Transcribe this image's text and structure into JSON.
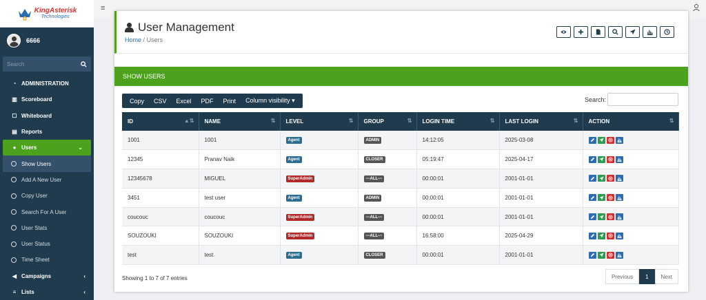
{
  "brand": {
    "name": "KingAsterisk",
    "sub": "Technologies"
  },
  "user": {
    "name": "6666"
  },
  "sidebar_search": {
    "placeholder": "Search"
  },
  "nav": {
    "administration": "ADMINISTRATION",
    "scoreboard": "Scoreboard",
    "whiteboard": "Whiteboard",
    "reports": "Reports",
    "users": "Users",
    "campaigns": "Campaigns",
    "lists": "Lists"
  },
  "sub_nav": [
    "Show Users",
    "Add A New User",
    "Copy User",
    "Search For A User",
    "User Stats",
    "User Status",
    "Time Sheet"
  ],
  "page": {
    "title": "User Management",
    "breadcrumb_home": "Home",
    "breadcrumb_sep": "/",
    "breadcrumb_current": "Users"
  },
  "section_header": "SHOW USERS",
  "export": {
    "copy": "Copy",
    "csv": "CSV",
    "excel": "Excel",
    "pdf": "PDF",
    "print": "Print",
    "colvis": "Column visibility ▾"
  },
  "table_search_label": "Search:",
  "columns": [
    "ID",
    "NAME",
    "LEVEL",
    "GROUP",
    "LOGIN TIME",
    "LAST LOGIN",
    "ACTION"
  ],
  "rows": [
    {
      "id": "1001",
      "name": "1001",
      "level": "Agent",
      "group": "ADMIN",
      "login": "14:12:05",
      "last": "2025-03-08"
    },
    {
      "id": "12345",
      "name": "Pranav Naik",
      "level": "Agent",
      "group": "CLOSER",
      "login": "05:19:47",
      "last": "2025-04-17"
    },
    {
      "id": "12345678",
      "name": "MIGUEL",
      "level": "SuperAdmin",
      "group": "---ALL---",
      "login": "00:00:01",
      "last": "2001-01-01"
    },
    {
      "id": "3451",
      "name": "test user",
      "level": "Agent",
      "group": "ADMIN",
      "login": "00:00:01",
      "last": "2001-01-01"
    },
    {
      "id": "coucouc",
      "name": "coucouc",
      "level": "SuperAdmin",
      "group": "---ALL---",
      "login": "00:00:01",
      "last": "2001-01-01"
    },
    {
      "id": "SOUZOUKI",
      "name": "SOUZOUKI",
      "level": "SuperAdmin",
      "group": "---ALL---",
      "login": "16:58:00",
      "last": "2025-04-29"
    },
    {
      "id": "test",
      "name": "test",
      "level": "Agent",
      "group": "CLOSER",
      "login": "00:00:01",
      "last": "2001-01-01"
    }
  ],
  "table_info": "Showing 1 to 7 of 7 entries",
  "pagination": {
    "previous": "Previous",
    "page": "1",
    "next": "Next"
  },
  "colors": {
    "sidebar": "#1f3b4d",
    "accent_green": "#4ca21d",
    "badge_agent": "#2d6b8f",
    "badge_super": "#b02a2a"
  }
}
